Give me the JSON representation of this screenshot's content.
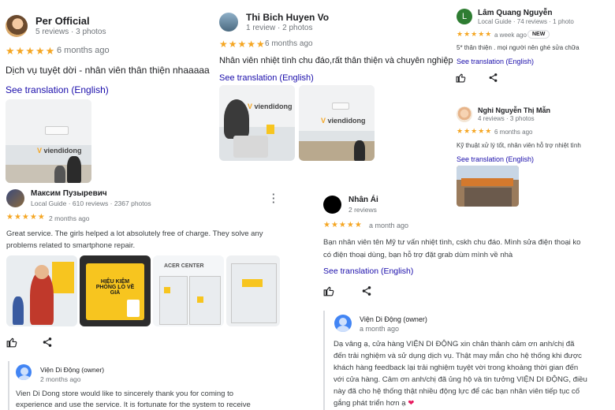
{
  "r1": {
    "name": "Per Official",
    "meta": "5 reviews · 3 photos",
    "stars": "★★★★★",
    "time": "6 months ago",
    "text": "Dịch vụ tuyệt dời - nhân viên thân thiện nhaaaaa",
    "translate": "See translation (English)"
  },
  "r2": {
    "name": "Thi Bich Huyen Vo",
    "meta": "1 review · 2 photos",
    "stars": "★★★★★",
    "time": "6 months ago",
    "text": "Nhân viên nhiệt tình chu đáo,rất thân thiện và chuyên nghiệp",
    "translate": "See translation (English)"
  },
  "r3": {
    "name": "Lâm Quang Nguyễn",
    "avatar_letter": "L",
    "meta": "Local Guide · 74 reviews · 1 photo",
    "stars": "★★★★★",
    "time": "a week ago",
    "badge": "NEW",
    "text": "5* thân thiện . mọi người nên ghé sửa chữa",
    "translate": "See translation (English)"
  },
  "r4": {
    "name": "Nghi Nguyễn Thị Mẫn",
    "meta": "4 reviews · 3 photos",
    "stars": "★★★★★",
    "time": "6 months ago",
    "text": "Kỹ thuật xử lý tốt, nhân viên hỗ trợ nhiệt tình",
    "translate": "See translation (English)"
  },
  "r5": {
    "name": "Максим Пузыревич",
    "meta": "Local Guide · 610 reviews · 2367 photos",
    "stars": "★★★★★",
    "time": "2 months ago",
    "text1": "Great service. The girls helped a lot absolutely free of charge. They solve any",
    "text2": "problems related to smartphone repair.",
    "owner_name": "Viện Di Động (owner)",
    "owner_time": "2 months ago",
    "owner_text1": "Vien Di Dong store would like to sincerely thank you for coming to",
    "owner_text2": "experience and use the service. It is fortunate for the system to receive",
    "photo2_text": "HIỆU KIỆM\nPHÒNG LO VỀ GIÁ",
    "photo3_text": "ACER CENTER"
  },
  "r6": {
    "name": "Nhân Ái",
    "meta": "2 reviews",
    "stars": "★★★★★",
    "time": "a month ago",
    "text1": "Bạn nhân viên tên Mỹ tư vấn nhiệt tình, cskh chu đáo. Mình sửa điện thoại ko",
    "text2": "có điện thoại dùng, bạn hỗ trợ đặt grab dùm mình về nhà",
    "translate": "See translation (English)",
    "owner_name": "Viện Di Động (owner)",
    "owner_time": "a month ago",
    "owner_text1": "Dạ vâng ạ, cửa hàng VIỆN DI ĐỘNG xin chân thành cảm ơn anh/chị đã",
    "owner_text2": "đến trải nghiệm và sử dụng dịch vụ. Thật may mắn cho hệ thống khi được",
    "owner_text3": "khách hàng feedback lại trải nghiệm tuyệt vời trong khoảng thời gian đến",
    "owner_text4": "với cửa hàng. Cảm ơn anh/chị đã ủng hộ và tin tưởng VIỆN DI ĐỘNG, điều",
    "owner_text5": "này đã cho hệ thống thật nhiều động lực để các bạn nhân viên tiếp tục cố",
    "owner_text6": "gắng phát triển hơn ạ"
  },
  "photos": {
    "logo": "viendidong",
    "logo_mark": "V"
  },
  "colors": {
    "star": "#f5a623",
    "link": "#1a0dab",
    "accent_yellow": "#f7c51f",
    "owner_avatar": "#4285f4",
    "heart": "#e8195e"
  }
}
